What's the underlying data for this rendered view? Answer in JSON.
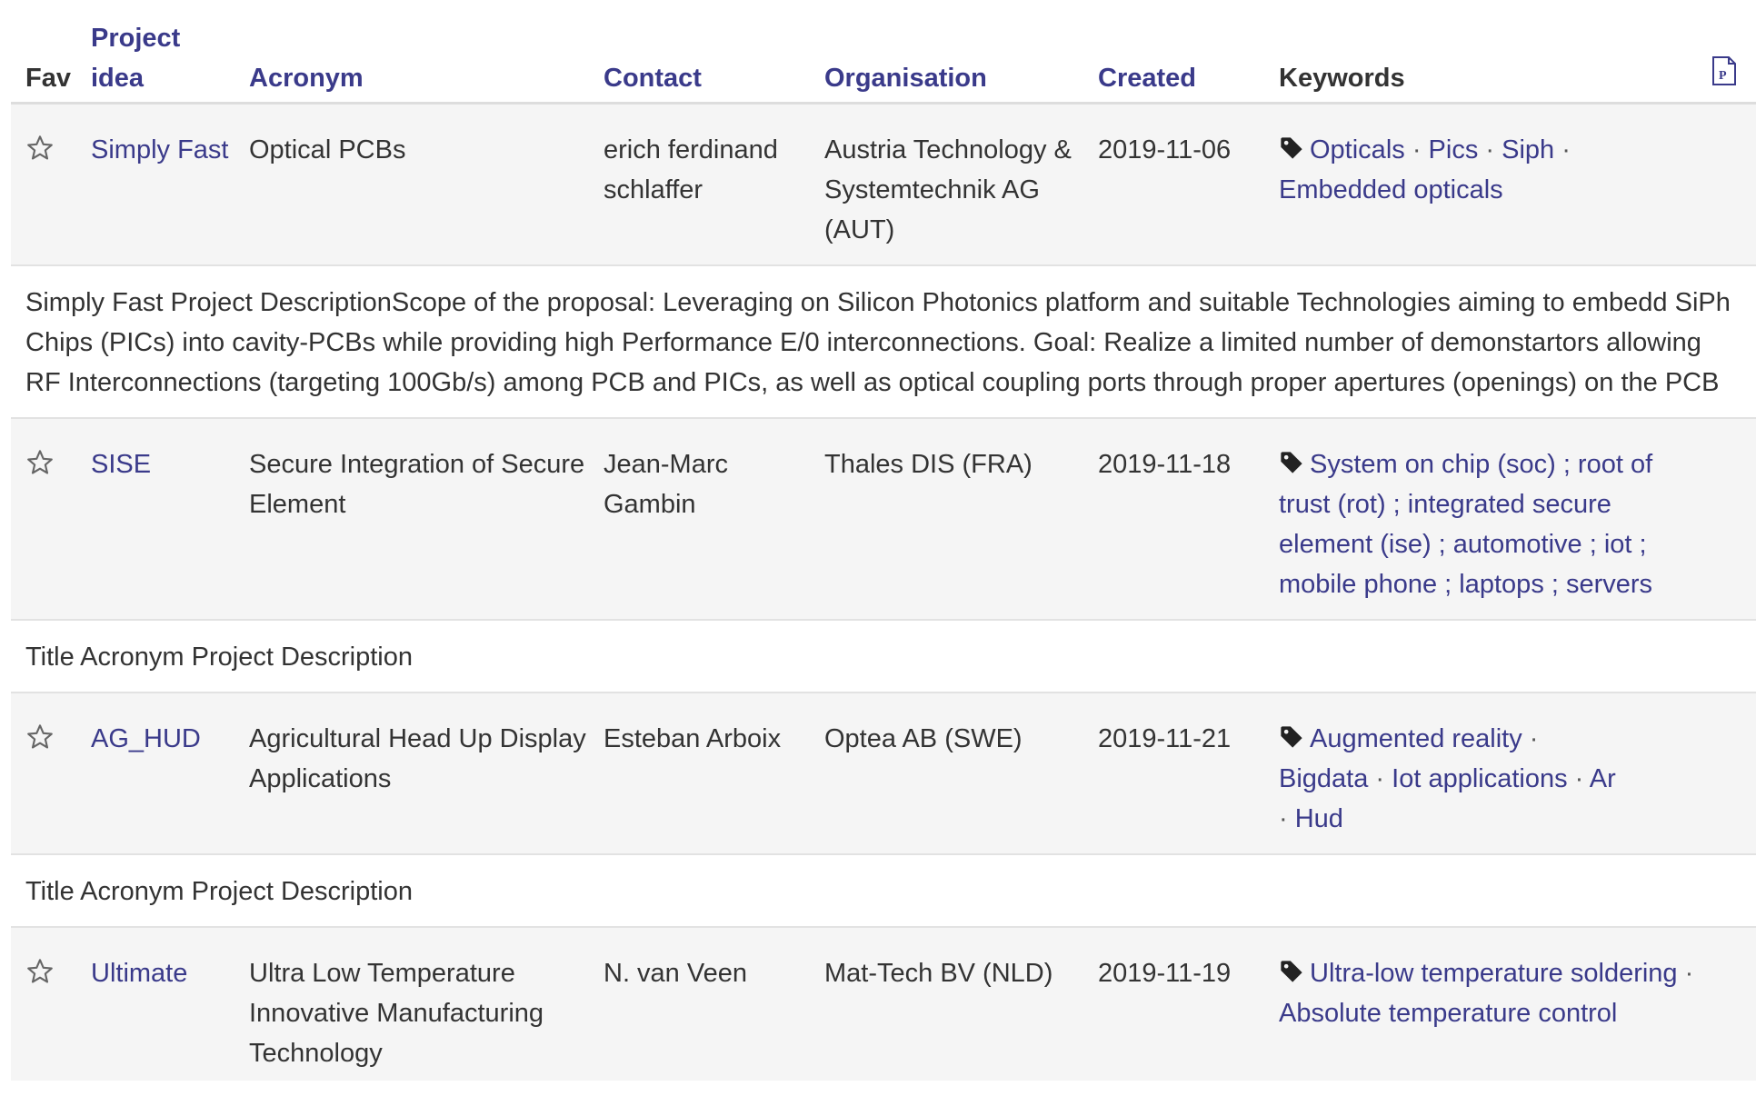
{
  "header": {
    "fav": "Fav",
    "project_idea_line1": "Project",
    "project_idea_line2": "idea",
    "acronym": "Acronym",
    "contact": "Contact",
    "organisation": "Organisation",
    "created": "Created",
    "keywords": "Keywords",
    "pdf_icon": "pdf-file-icon"
  },
  "rows": [
    {
      "idea": "Simply Fast",
      "acronym": "Optical PCBs",
      "contact": "erich ferdinand schlaffer",
      "organisation": "Austria Technology & Systemtechnik AG (AUT)",
      "created": "2019-11-06",
      "keywords": [
        "Opticals",
        "Pics",
        "Siph",
        "Embedded opticals"
      ],
      "description": "Simply Fast Project DescriptionScope of the proposal: Leveraging on Silicon Photonics platform and suitable Technologies aiming to embedd SiPh Chips (PICs) into cavity-PCBs while providing high Performance E/0 interconnections. Goal: Realize a limited number of demonstartors allowing RF Interconnections (targeting 100Gb/s) among PCB and PICs, as well as optical coupling ports through proper apertures (openings) on the PCB"
    },
    {
      "idea": "SISE",
      "acronym": "Secure Integration of Secure Element",
      "contact": "Jean-Marc Gambin",
      "organisation": "Thales DIS (FRA)",
      "created": "2019-11-18",
      "keyword_text": "System on chip (soc) ; root of trust (rot) ; integrated secure element (ise) ; automotive ; iot ; mobile phone ; laptops ; servers",
      "description": "Title Acronym Project Description"
    },
    {
      "idea": "AG_HUD",
      "acronym": "Agricultural Head Up Display Applications",
      "contact": "Esteban Arboix",
      "organisation": "Optea AB (SWE)",
      "created": "2019-11-21",
      "keywords": [
        "Augmented reality",
        "Bigdata",
        "Iot applications",
        "Ar",
        "Hud"
      ],
      "description": "Title Acronym Project Description"
    },
    {
      "idea": "Ultimate",
      "acronym": "Ultra Low Temperature Innovative Manufacturing Technology",
      "contact": "N. van Veen",
      "organisation": "Mat-Tech BV (NLD)",
      "created": "2019-11-19",
      "keywords": [
        "Ultra-low temperature soldering",
        "Absolute temperature control"
      ]
    }
  ],
  "icons": {
    "favorite": "star-outline-icon",
    "keyword": "tag-icon"
  },
  "colors": {
    "link": "#3a3a8a",
    "row_bg": "#f5f5f5",
    "border": "#dddddd"
  },
  "separator": "·"
}
